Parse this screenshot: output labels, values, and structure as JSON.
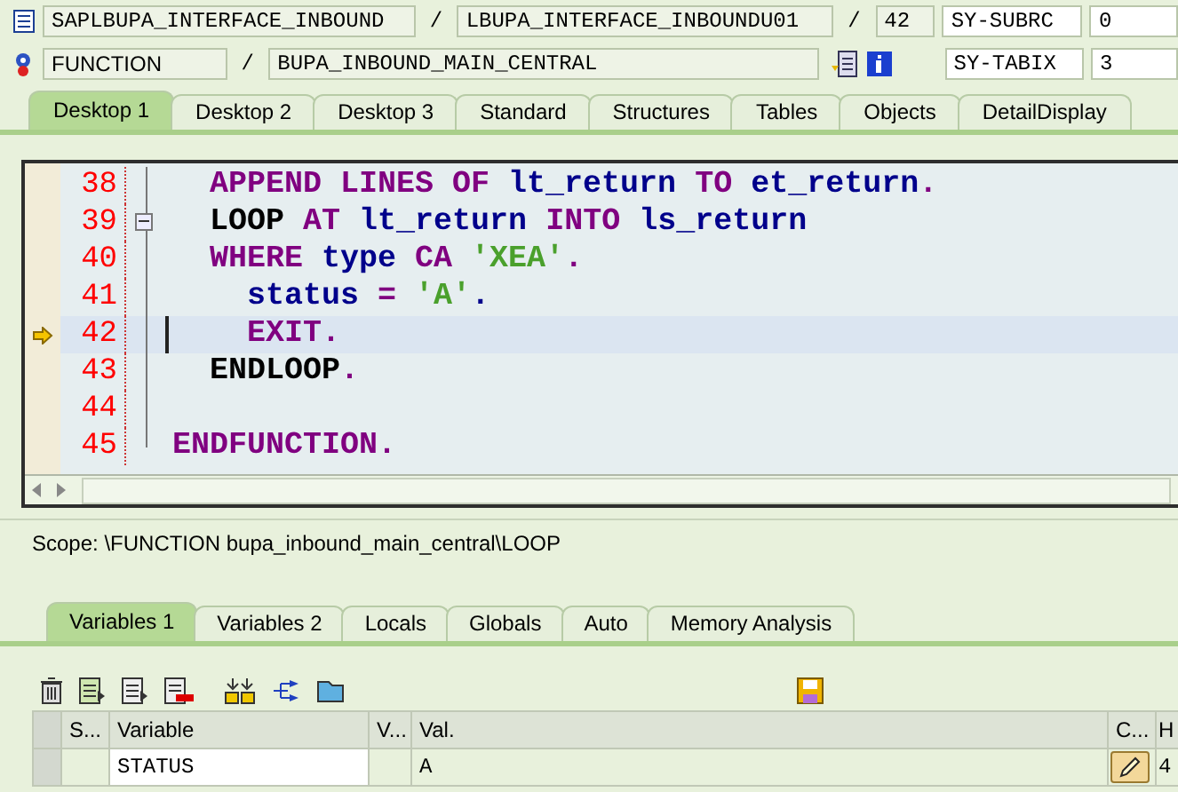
{
  "header": {
    "program": "SAPLBUPA_INTERFACE_INBOUND",
    "separator_1": "/",
    "include": "LBUPA_INTERFACE_INBOUNDU01",
    "separator_2": "/",
    "line": "42",
    "sy_field_1": "SY-SUBRC",
    "sy_value_1": "0",
    "event_type": "FUNCTION",
    "separator_3": "/",
    "event_name": "BUPA_INBOUND_MAIN_CENTRAL",
    "sy_field_2": "SY-TABIX",
    "sy_value_2": "3"
  },
  "tabs": [
    {
      "label": "Desktop 1",
      "selected": true
    },
    {
      "label": "Desktop 2",
      "selected": false
    },
    {
      "label": "Desktop 3",
      "selected": false
    },
    {
      "label": "Standard",
      "selected": false
    },
    {
      "label": "Structures",
      "selected": false
    },
    {
      "label": "Tables",
      "selected": false
    },
    {
      "label": "Objects",
      "selected": false
    },
    {
      "label": "DetailDisplay",
      "selected": false
    }
  ],
  "code": [
    {
      "number": "38",
      "current": false,
      "fold_open": false,
      "tokens": [
        {
          "kind": "keyword",
          "text": "  APPEND LINES OF "
        },
        {
          "kind": "name",
          "text": "lt_return "
        },
        {
          "kind": "keyword",
          "text": "TO "
        },
        {
          "kind": "name",
          "text": "et_return"
        },
        {
          "kind": "keyword",
          "text": "."
        }
      ]
    },
    {
      "number": "39",
      "current": false,
      "fold_open": true,
      "tokens": [
        {
          "kind": "block",
          "text": "  LOOP "
        },
        {
          "kind": "keyword",
          "text": "AT "
        },
        {
          "kind": "name",
          "text": "lt_return "
        },
        {
          "kind": "keyword",
          "text": "INTO "
        },
        {
          "kind": "name",
          "text": "ls_return"
        }
      ]
    },
    {
      "number": "40",
      "current": false,
      "fold_open": false,
      "tokens": [
        {
          "kind": "keyword",
          "text": "  WHERE "
        },
        {
          "kind": "name",
          "text": "type "
        },
        {
          "kind": "keyword",
          "text": "CA "
        },
        {
          "kind": "literal",
          "text": "'XEA'"
        },
        {
          "kind": "keyword",
          "text": "."
        }
      ]
    },
    {
      "number": "41",
      "current": false,
      "fold_open": false,
      "tokens": [
        {
          "kind": "name",
          "text": "    status "
        },
        {
          "kind": "keyword",
          "text": "= "
        },
        {
          "kind": "literal",
          "text": "'A'"
        },
        {
          "kind": "name",
          "text": "."
        }
      ]
    },
    {
      "number": "42",
      "current": true,
      "fold_open": false,
      "tokens": [
        {
          "kind": "keyword",
          "text": "    EXIT."
        }
      ]
    },
    {
      "number": "43",
      "current": false,
      "fold_open": false,
      "tokens": [
        {
          "kind": "block",
          "text": "  ENDLOOP"
        },
        {
          "kind": "keyword",
          "text": "."
        }
      ]
    },
    {
      "number": "44",
      "current": false,
      "fold_open": false
    },
    {
      "number": "45",
      "current": false,
      "fold_open": false,
      "tokens": [
        {
          "kind": "keyword",
          "text": "ENDFUNCTION."
        }
      ]
    }
  ],
  "scope": "Scope: \\FUNCTION bupa_inbound_main_central\\LOOP",
  "lower_tabs": [
    {
      "label": "Variables 1",
      "selected": true
    },
    {
      "label": "Variables 2",
      "selected": false
    },
    {
      "label": "Locals",
      "selected": false
    },
    {
      "label": "Globals",
      "selected": false
    },
    {
      "label": "Auto",
      "selected": false
    },
    {
      "label": "Memory Analysis",
      "selected": false
    }
  ],
  "table": {
    "columns": [
      "S...",
      "Variable",
      "V...",
      "Val.",
      "C...",
      "H"
    ],
    "rows": [
      {
        "variable": "STATUS",
        "value": "A",
        "column_7": "4"
      }
    ]
  }
}
